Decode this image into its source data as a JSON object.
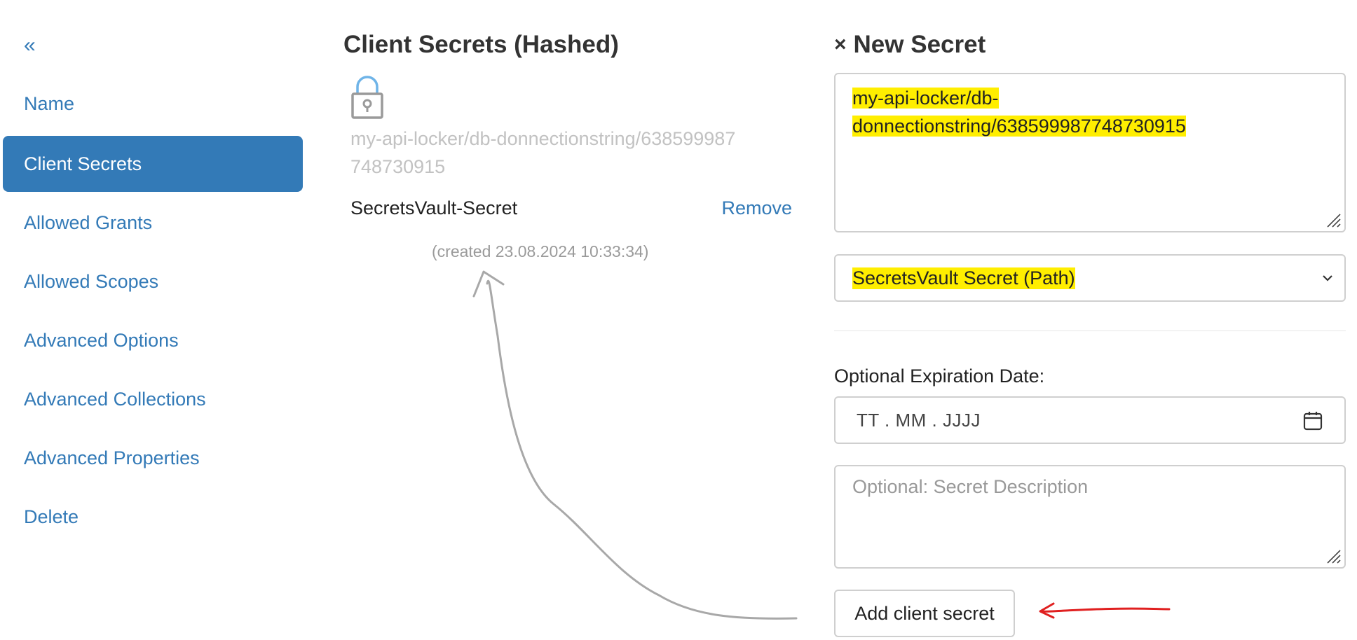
{
  "sidebar": {
    "collapse_label": "«",
    "items": [
      {
        "label": "Name",
        "active": false
      },
      {
        "label": "Client Secrets",
        "active": true
      },
      {
        "label": "Allowed Grants",
        "active": false
      },
      {
        "label": "Allowed Scopes",
        "active": false
      },
      {
        "label": "Advanced Options",
        "active": false
      },
      {
        "label": "Advanced Collections",
        "active": false
      },
      {
        "label": "Advanced Properties",
        "active": false
      },
      {
        "label": "Delete",
        "active": false
      }
    ]
  },
  "client_secrets": {
    "title": "Client Secrets (Hashed)",
    "hashed_value": "my-api-locker/db-donnectionstring/638599987748730915",
    "secret_name": "SecretsVault-Secret",
    "remove_label": "Remove",
    "created_text": "(created 23.08.2024 10:33:34)"
  },
  "new_secret": {
    "close_label": "×",
    "title": "New Secret",
    "value_line1": "my-api-locker/db-",
    "value_line2": "donnectionstring/638599987748730915",
    "type_selected": "SecretsVault Secret (Path)",
    "expiration_label": "Optional Expiration Date:",
    "date_placeholder": "TT . MM . JJJJ",
    "description_placeholder": "Optional: Secret Description",
    "add_button_label": "Add client secret"
  },
  "colors": {
    "accent": "#337ab7",
    "highlight": "#ffee00",
    "annotation_arrow_gray": "#a8a8a8",
    "annotation_arrow_red": "#e02020"
  }
}
